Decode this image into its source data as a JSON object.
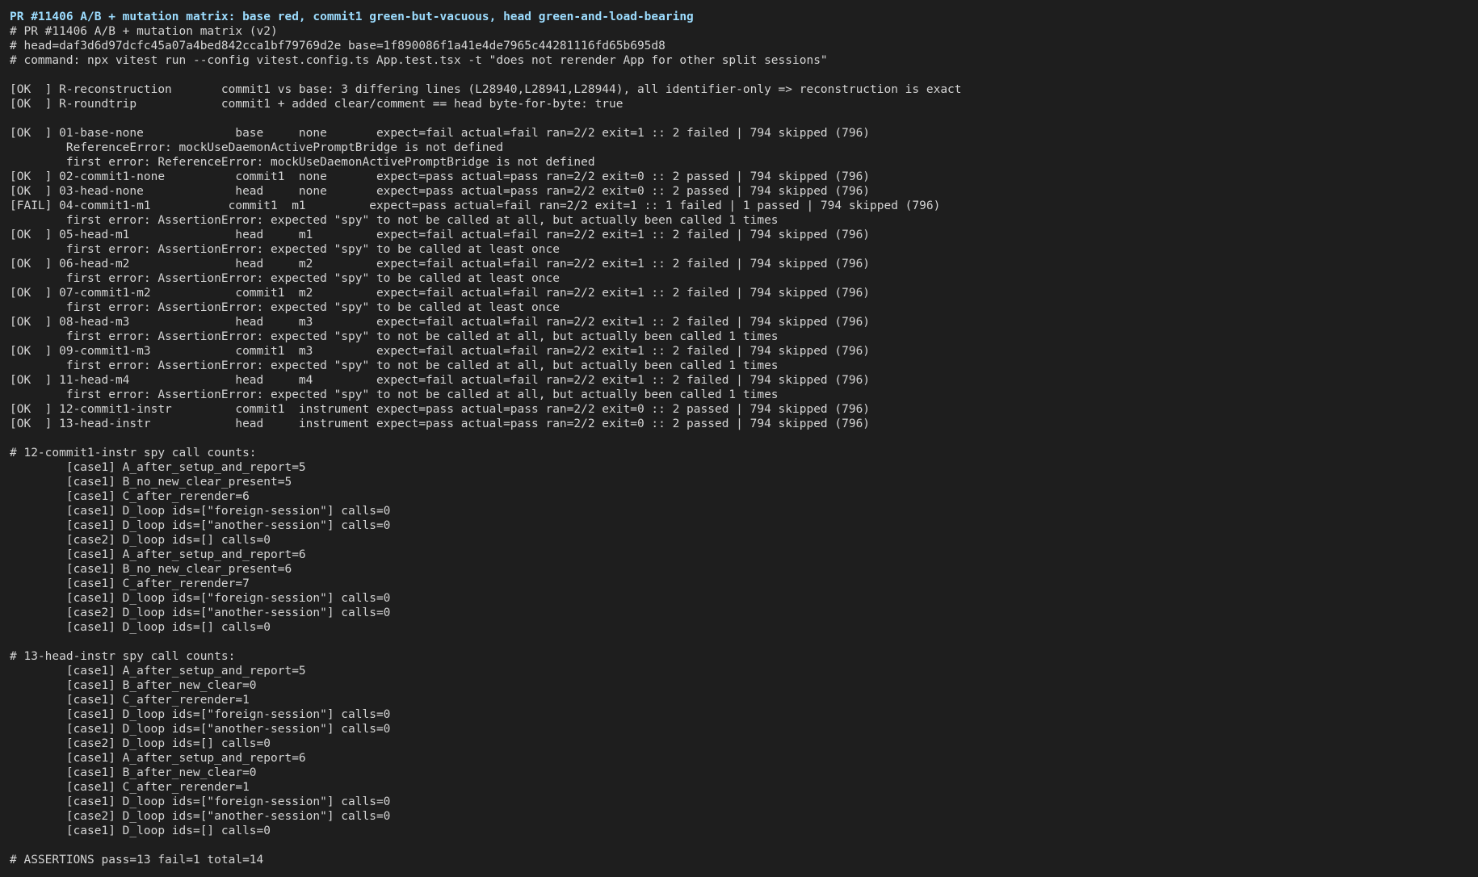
{
  "terminal": {
    "title": "PR #11406 A/B + mutation matrix: base red, commit1 green-but-vacuous, head green-and-load-bearing",
    "lines": [
      "# PR #11406 A/B + mutation matrix (v2)",
      "# head=daf3d6d97dcfc45a07a4bed842cca1bf79769d2e base=1f890086f1a41e4de7965c44281116fd65b695d8",
      "# command: npx vitest run --config vitest.config.ts App.test.tsx -t \"does not rerender App for other split sessions\"",
      "",
      "[OK  ] R-reconstruction       commit1 vs base: 3 differing lines (L28940,L28941,L28944), all identifier-only => reconstruction is exact",
      "[OK  ] R-roundtrip            commit1 + added clear/comment == head byte-for-byte: true",
      "",
      "[OK  ] 01-base-none             base     none       expect=fail actual=fail ran=2/2 exit=1 :: 2 failed | 794 skipped (796)",
      "        ReferenceError: mockUseDaemonActivePromptBridge is not defined",
      "        first error: ReferenceError: mockUseDaemonActivePromptBridge is not defined",
      "[OK  ] 02-commit1-none          commit1  none       expect=pass actual=pass ran=2/2 exit=0 :: 2 passed | 794 skipped (796)",
      "[OK  ] 03-head-none             head     none       expect=pass actual=pass ran=2/2 exit=0 :: 2 passed | 794 skipped (796)",
      "[FAIL] 04-commit1-m1           commit1  m1         expect=pass actual=fail ran=2/2 exit=1 :: 1 failed | 1 passed | 794 skipped (796)",
      "        first error: AssertionError: expected \"spy\" to not be called at all, but actually been called 1 times",
      "[OK  ] 05-head-m1               head     m1         expect=fail actual=fail ran=2/2 exit=1 :: 2 failed | 794 skipped (796)",
      "        first error: AssertionError: expected \"spy\" to be called at least once",
      "[OK  ] 06-head-m2               head     m2         expect=fail actual=fail ran=2/2 exit=1 :: 2 failed | 794 skipped (796)",
      "        first error: AssertionError: expected \"spy\" to be called at least once",
      "[OK  ] 07-commit1-m2            commit1  m2         expect=fail actual=fail ran=2/2 exit=1 :: 2 failed | 794 skipped (796)",
      "        first error: AssertionError: expected \"spy\" to be called at least once",
      "[OK  ] 08-head-m3               head     m3         expect=fail actual=fail ran=2/2 exit=1 :: 2 failed | 794 skipped (796)",
      "        first error: AssertionError: expected \"spy\" to not be called at all, but actually been called 1 times",
      "[OK  ] 09-commit1-m3            commit1  m3         expect=fail actual=fail ran=2/2 exit=1 :: 2 failed | 794 skipped (796)",
      "        first error: AssertionError: expected \"spy\" to not be called at all, but actually been called 1 times",
      "[OK  ] 11-head-m4               head     m4         expect=fail actual=fail ran=2/2 exit=1 :: 2 failed | 794 skipped (796)",
      "        first error: AssertionError: expected \"spy\" to not be called at all, but actually been called 1 times",
      "[OK  ] 12-commit1-instr         commit1  instrument expect=pass actual=pass ran=2/2 exit=0 :: 2 passed | 794 skipped (796)",
      "[OK  ] 13-head-instr            head     instrument expect=pass actual=pass ran=2/2 exit=0 :: 2 passed | 794 skipped (796)",
      "",
      "# 12-commit1-instr spy call counts:",
      "        [case1] A_after_setup_and_report=5",
      "        [case1] B_no_new_clear_present=5",
      "        [case1] C_after_rerender=6",
      "        [case1] D_loop ids=[\"foreign-session\"] calls=0",
      "        [case1] D_loop ids=[\"another-session\"] calls=0",
      "        [case2] D_loop ids=[] calls=0",
      "        [case1] A_after_setup_and_report=6",
      "        [case1] B_no_new_clear_present=6",
      "        [case1] C_after_rerender=7",
      "        [case1] D_loop ids=[\"foreign-session\"] calls=0",
      "        [case2] D_loop ids=[\"another-session\"] calls=0",
      "        [case1] D_loop ids=[] calls=0",
      "",
      "# 13-head-instr spy call counts:",
      "        [case1] A_after_setup_and_report=5",
      "        [case1] B_after_new_clear=0",
      "        [case1] C_after_rerender=1",
      "        [case1] D_loop ids=[\"foreign-session\"] calls=0",
      "        [case1] D_loop ids=[\"another-session\"] calls=0",
      "        [case2] D_loop ids=[] calls=0",
      "        [case1] A_after_setup_and_report=6",
      "        [case1] B_after_new_clear=0",
      "        [case1] C_after_rerender=1",
      "        [case1] D_loop ids=[\"foreign-session\"] calls=0",
      "        [case2] D_loop ids=[\"another-session\"] calls=0",
      "        [case1] D_loop ids=[] calls=0",
      "",
      "# ASSERTIONS pass=13 fail=1 total=14"
    ]
  }
}
